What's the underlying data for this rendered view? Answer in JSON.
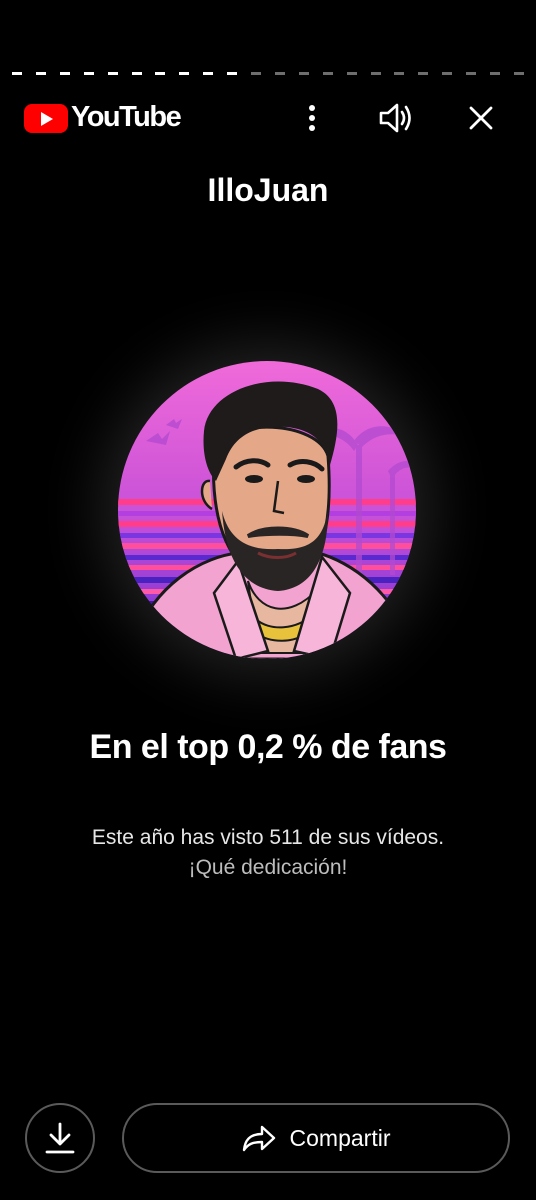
{
  "story_progress": {
    "total_segments": 22,
    "completed_segments": 10
  },
  "header": {
    "logo_text": "YouTube",
    "icons": [
      "more-vert-icon",
      "volume-icon",
      "close-icon"
    ]
  },
  "channel": {
    "name": "IlloJuan"
  },
  "headline": "En el top 0,2 % de fans",
  "body": {
    "line1": "Este año has visto 511 de sus vídeos.",
    "line2": "¡Qué dedicación!"
  },
  "actions": {
    "download_icon": "download-icon",
    "share_icon": "share-arrow-icon",
    "share_label": "Compartir"
  },
  "colors": {
    "background": "#000000",
    "brand_red": "#ff0000",
    "avatar_bg": "#e25bd0"
  }
}
